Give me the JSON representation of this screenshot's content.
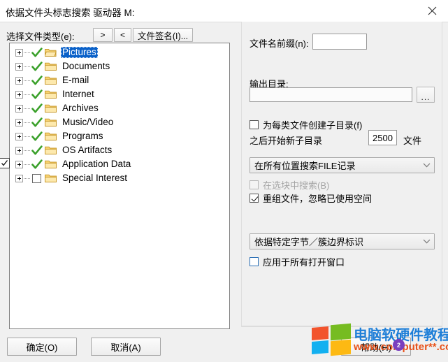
{
  "window": {
    "title": "依据文件头标志搜索 驱动器 M:",
    "close_icon": "close-icon"
  },
  "toolbar": {
    "filetype_label": "选择文件类型(e):",
    "next_label": ">",
    "prev_label": "<",
    "signature_label": "文件签名(I)..."
  },
  "tree": {
    "items": [
      {
        "label": "Pictures",
        "checked": true,
        "selected": true,
        "folder": "open"
      },
      {
        "label": "Documents",
        "checked": true,
        "selected": false,
        "folder": "closed"
      },
      {
        "label": "E-mail",
        "checked": true,
        "selected": false,
        "folder": "closed"
      },
      {
        "label": "Internet",
        "checked": true,
        "selected": false,
        "folder": "closed"
      },
      {
        "label": "Archives",
        "checked": true,
        "selected": false,
        "folder": "closed"
      },
      {
        "label": "Music/Video",
        "checked": true,
        "selected": false,
        "folder": "closed"
      },
      {
        "label": "Programs",
        "checked": true,
        "selected": false,
        "folder": "closed"
      },
      {
        "label": "OS Artifacts",
        "checked": true,
        "selected": false,
        "folder": "closed"
      },
      {
        "label": "Application Data",
        "checked": true,
        "selected": false,
        "folder": "closed"
      },
      {
        "label": "Special Interest",
        "checked": false,
        "selected": false,
        "folder": "closed"
      }
    ]
  },
  "options": {
    "prefix_label": "文件名前缀(n):",
    "prefix_value": "",
    "prefix_placeholder": "",
    "outdir_label": "输出目录:",
    "outdir_value": "",
    "outdir_placeholder": "",
    "browse_label": "...",
    "subdir_checkbox_label": "为每类文件创建子目录(f)",
    "subdir_checked": false,
    "newsub_label": "之后开始新子目录",
    "newsub_value": "2500",
    "files_label": "文件",
    "filerec_combo_value": "在所有位置搜索FILE记录",
    "block_checkbox_label": "在选块中搜索(B)",
    "block_checked": false,
    "block_disabled": true,
    "regroup_checkbox_label": "重组文件，忽略已使用空间",
    "regroup_checked": true,
    "byte_combo_value": "依据特定字节／簇边界标识",
    "applyall_checkbox_label": "应用于所有打开窗口",
    "applyall_checked": false
  },
  "footer": {
    "ok_label": "确定(O)",
    "cancel_label": "取消(A)",
    "help_label": "帮助(H)"
  },
  "watermark": {
    "title": "电脑软硬件教程网",
    "url": "www.computer**.com",
    "badge": "2",
    "logo_icon": "windows-logo-icon",
    "colors": {
      "title": "#1f7fd8",
      "url": "#e8521a",
      "logo_q1": "#f2542d",
      "logo_q2": "#76bc21",
      "logo_q3": "#13b0f0",
      "logo_q4": "#fdb913"
    }
  }
}
